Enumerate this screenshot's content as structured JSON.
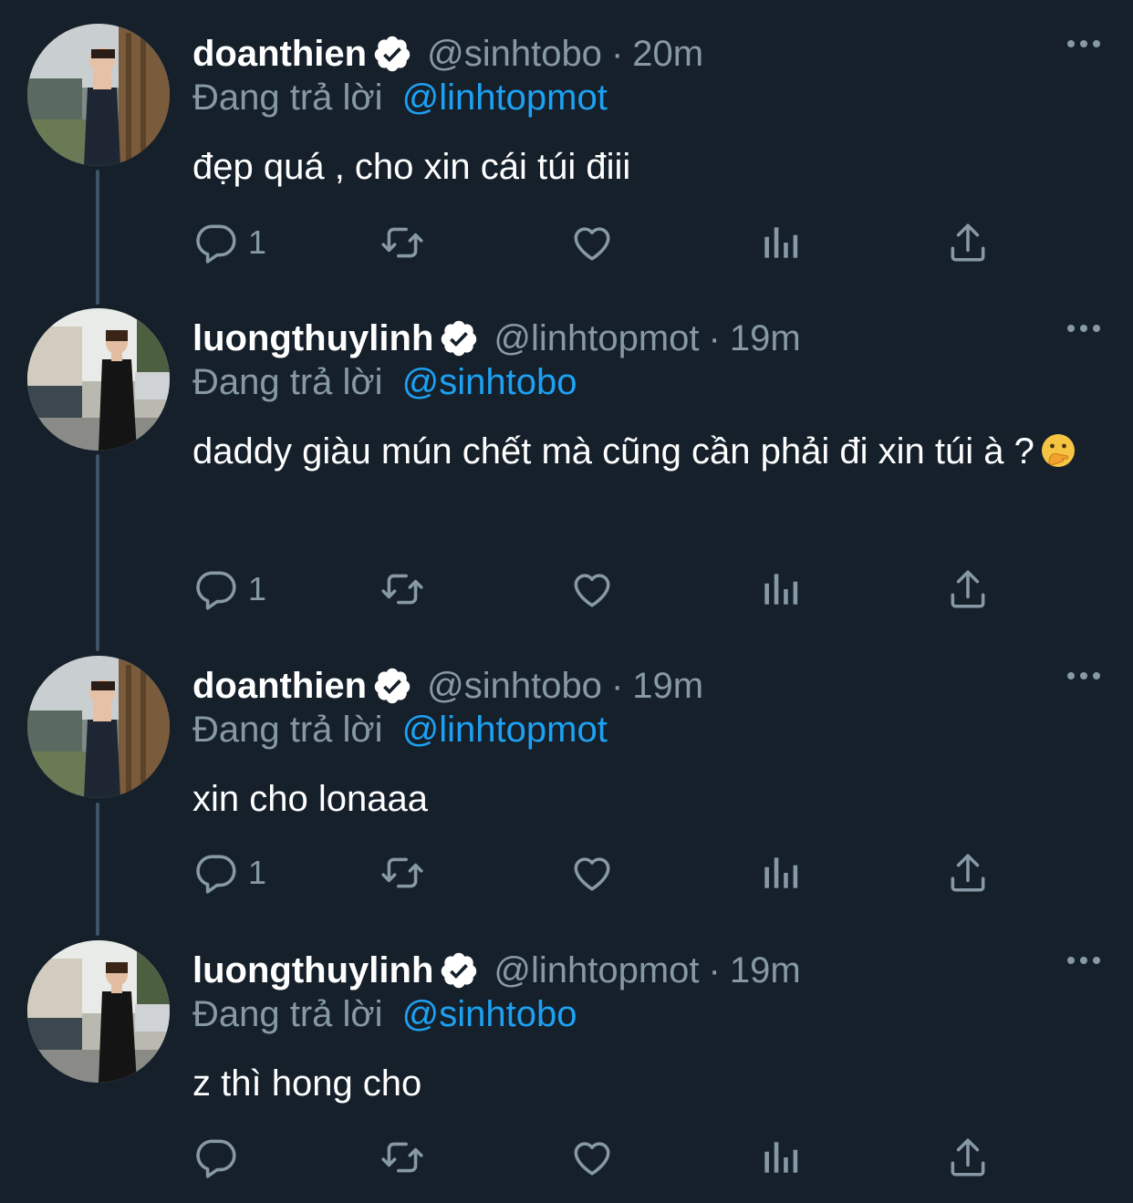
{
  "tweets": [
    {
      "display_name": "doanthien",
      "handle": "@sinhtobo",
      "separator": "·",
      "time": "20m",
      "reply_label": "Đang trả lời",
      "reply_to": "@linhtopmot",
      "text": "đẹp quá , cho xin cái túi điii",
      "reply_count": "1",
      "avatar_icon": "avatar-photo-icon"
    },
    {
      "display_name": "luongthuylinh",
      "handle": "@linhtopmot",
      "separator": "·",
      "time": "19m",
      "reply_label": "Đang trả lời",
      "reply_to": "@sinhtobo",
      "text": "daddy giàu mún chết mà cũng cần phải đi xin túi à ?",
      "emoji": "hand-over-mouth-emoji",
      "reply_count": "1",
      "avatar_icon": "avatar-photo-icon"
    },
    {
      "display_name": "doanthien",
      "handle": "@sinhtobo",
      "separator": "·",
      "time": "19m",
      "reply_label": "Đang trả lời",
      "reply_to": "@linhtopmot",
      "text": "xin cho lonaaa",
      "reply_count": "1",
      "avatar_icon": "avatar-photo-icon"
    },
    {
      "display_name": "luongthuylinh",
      "handle": "@linhtopmot",
      "separator": "·",
      "time": "19m",
      "reply_label": "Đang trả lời",
      "reply_to": "@sinhtobo",
      "text": "z thì hong cho",
      "reply_count": "",
      "avatar_icon": "avatar-photo-icon"
    }
  ],
  "colors": {
    "background": "#15202b",
    "secondary_text": "#8899a6",
    "link": "#1da1f2",
    "verified": "#ffffff",
    "thread_line": "#3d5466"
  },
  "action_icons": [
    "reply-icon",
    "retweet-icon",
    "like-icon",
    "views-icon",
    "share-icon"
  ]
}
